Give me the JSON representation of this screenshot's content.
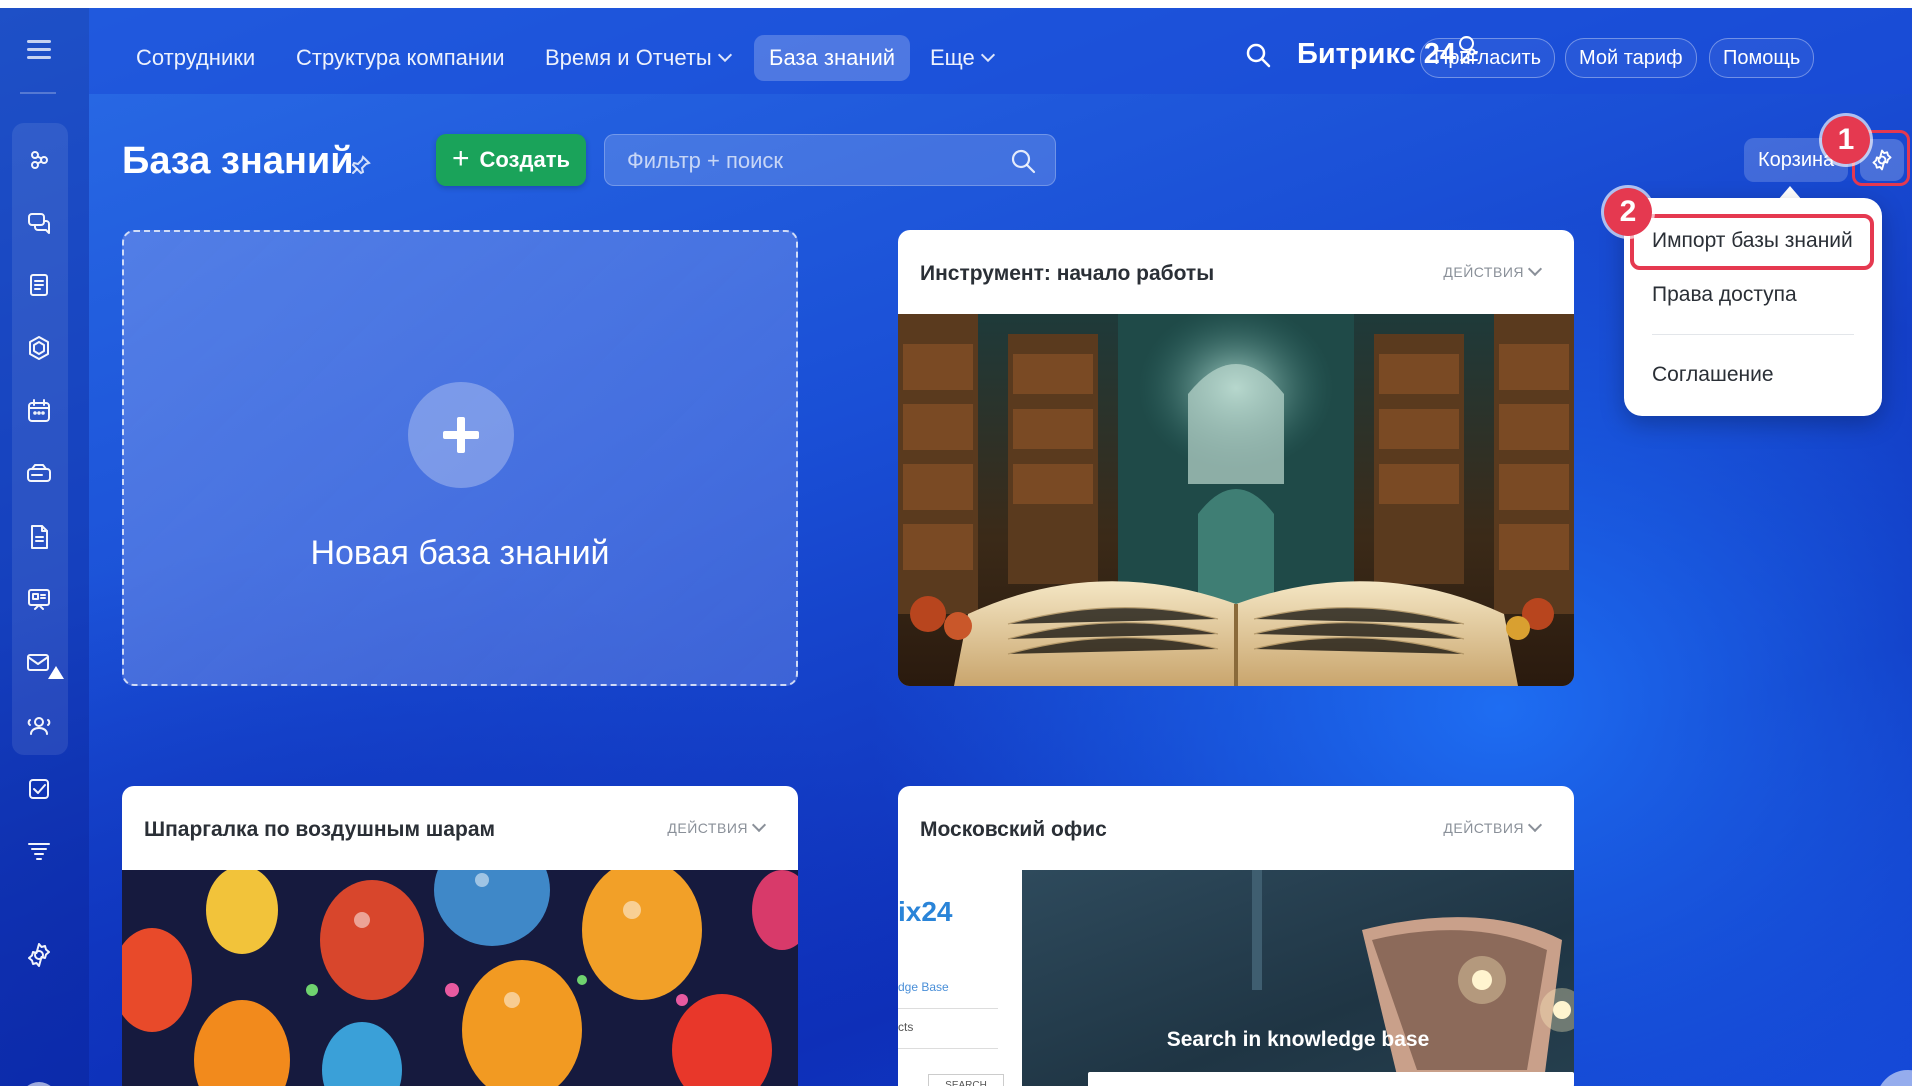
{
  "nav": {
    "items": [
      {
        "label": "Сотрудники"
      },
      {
        "label": "Структура компании"
      },
      {
        "label": "Время и Отчеты"
      },
      {
        "label": "База знаний"
      },
      {
        "label": "Еще"
      }
    ],
    "active_index": 3
  },
  "header": {
    "brand": "Битрикс 24",
    "invite_label": "Пригласить",
    "tariff_label": "Мой тариф",
    "help_label": "Помощь"
  },
  "page": {
    "title": "База знаний",
    "create_label": "Создать",
    "filter_placeholder": "Фильтр + поиск",
    "trash_label": "Корзина"
  },
  "badges": {
    "first": "1",
    "second": "2"
  },
  "settings_menu": {
    "items": [
      {
        "label": "Импорт базы знаний"
      },
      {
        "label": "Права доступа"
      },
      {
        "label": "Соглашение"
      }
    ]
  },
  "cards": {
    "new_kb_label": "Новая база знаний",
    "actions_label": "ДЕЙСТВИЯ",
    "items": [
      {
        "title": "Инструмент: начало работы"
      },
      {
        "title": "Шпаргалка по воздушным шарам"
      },
      {
        "title": "Московский офис"
      }
    ]
  },
  "office_cover": {
    "logo": "ix24",
    "kb_link": "dge Base",
    "cts": "cts",
    "mini_search": "SEARCH",
    "search_title": "Search in knowledge base"
  },
  "colors": {
    "accent_red": "#e53950",
    "create_green": "#1aa35a"
  }
}
